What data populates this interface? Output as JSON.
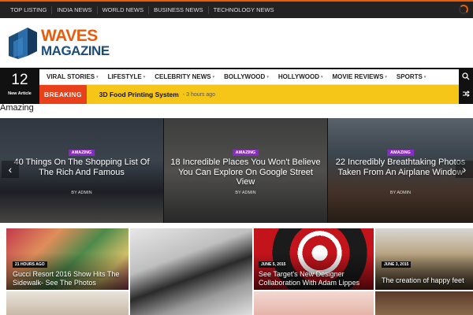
{
  "top_nav": {
    "items": [
      "TOP LISTING",
      "INDIA NEWS",
      "WORLD NEWS",
      "BUSINESS NEWS",
      "TECHNOLOGY NEWS"
    ]
  },
  "logo": {
    "line1": "WAVES",
    "line2": "MAGAZINE"
  },
  "date_box": {
    "day": "12",
    "caption": "New Article"
  },
  "main_nav": {
    "items": [
      "VIRAL STORIES",
      "LIFESTYLE",
      "CELEBRITY NEWS",
      "BOLLYWOOD",
      "HOLLYWOOD",
      "MOVIE REVIEWS",
      "SPORTS"
    ]
  },
  "breaking": {
    "label": "BREAKING",
    "headline": "3D Food Printing System",
    "time": "- 3 hours ago"
  },
  "section_title": "Amazing",
  "slider": {
    "slides": [
      {
        "category": "AMAZING",
        "title": "40 Things On The Shopping List Of The Rich And Famous",
        "byline": "BY ADMIN"
      },
      {
        "category": "AMAZING",
        "title": "18 Incredible Places You Won't Believe You Can Explore On Google Street View",
        "byline": "BY ADMIN"
      },
      {
        "category": "AMAZING",
        "title": "22 Incredibly Breathtaking Photos Taken From An Airplane Window",
        "byline": "BY ADMIN"
      }
    ],
    "prev": "‹",
    "next": "›"
  },
  "grid": {
    "tiles": [
      {
        "date": "21 HOURS AGO",
        "title": "Gucci Resort 2016 Show Hits The Sidewalk- See The Photos"
      },
      {
        "date": "JUNE 5, 2015",
        "title": "See Target's New Designer Collaboration With Adam Lippes"
      },
      {
        "date": "JUNE 3, 2015",
        "title": "The creation of happy feet"
      }
    ]
  },
  "colors": {
    "accent": "#e85c0d",
    "breaking_bg": "#f5c518",
    "breaking_label": "#e8401a",
    "category": "#8a2bc5",
    "logo_blue": "#1a4c7c"
  },
  "icons": {
    "search": "search-icon",
    "shuffle": "shuffle-icon",
    "loader": "loader-icon"
  }
}
